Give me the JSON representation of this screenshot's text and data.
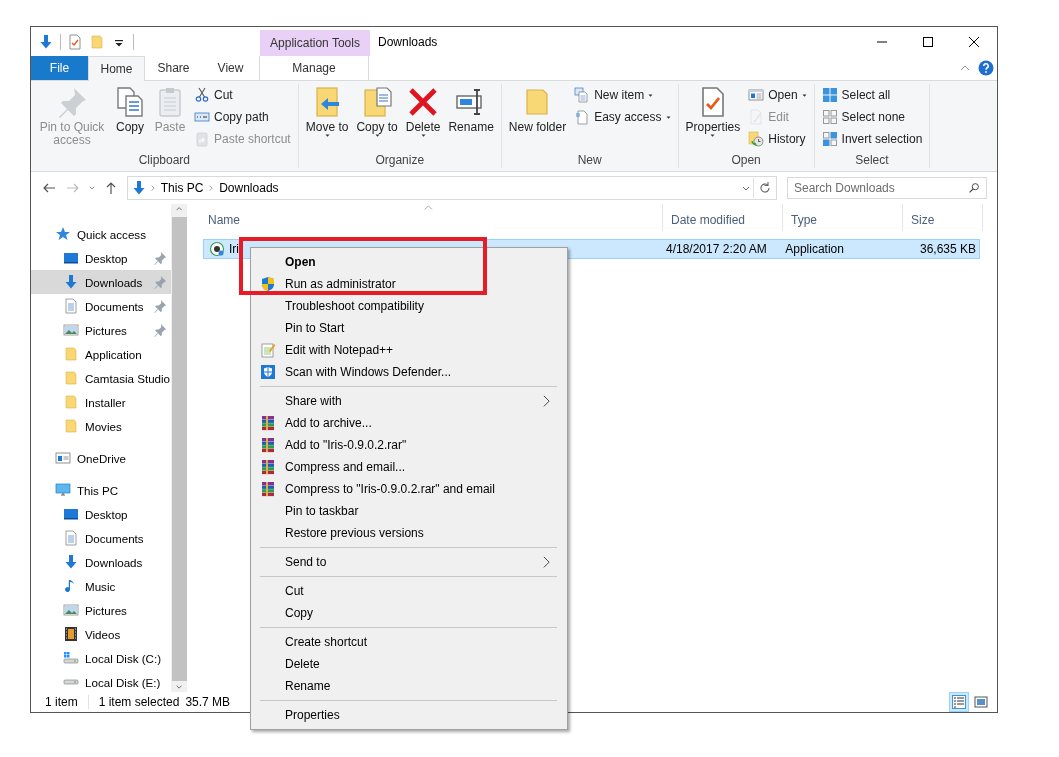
{
  "window": {
    "title": "Downloads",
    "contextual_tab_group": "Application Tools"
  },
  "ribbon_tabs": [
    {
      "label": "File",
      "kind": "file",
      "selected": false
    },
    {
      "label": "Home",
      "kind": "tab",
      "selected": true
    },
    {
      "label": "Share",
      "kind": "tab",
      "selected": false
    },
    {
      "label": "View",
      "kind": "tab",
      "selected": false
    },
    {
      "label": "Manage",
      "kind": "contextual",
      "selected": false
    }
  ],
  "ribbon_groups": [
    {
      "label": "Clipboard",
      "columns": [
        {
          "kind": "large",
          "commands": [
            {
              "label": "Pin to Quick access",
              "kind": "pin",
              "dropdown": false,
              "disabled": true
            }
          ]
        },
        {
          "kind": "large",
          "commands": [
            {
              "label": "Copy",
              "kind": "copy",
              "dropdown": false,
              "disabled": false
            }
          ]
        },
        {
          "kind": "large",
          "commands": [
            {
              "label": "Paste",
              "kind": "paste",
              "dropdown": false,
              "disabled": true
            }
          ]
        },
        {
          "kind": "stack",
          "commands": [
            {
              "label": "Cut",
              "kind": "cut",
              "dropdown": false,
              "disabled": false
            },
            {
              "label": "Copy path",
              "kind": "copy-path",
              "dropdown": false,
              "disabled": false
            },
            {
              "label": "Paste shortcut",
              "kind": "paste-shortcut",
              "dropdown": false,
              "disabled": true
            }
          ]
        }
      ]
    },
    {
      "label": "Organize",
      "columns": [
        {
          "kind": "large",
          "commands": [
            {
              "label": "Move to",
              "kind": "move",
              "dropdown": true,
              "disabled": false
            }
          ]
        },
        {
          "kind": "large",
          "commands": [
            {
              "label": "Copy to",
              "kind": "copy-to",
              "dropdown": true,
              "disabled": false
            }
          ]
        },
        {
          "kind": "large",
          "commands": [
            {
              "label": "Delete",
              "kind": "delete",
              "dropdown": true,
              "disabled": false
            }
          ]
        },
        {
          "kind": "large",
          "commands": [
            {
              "label": "Rename",
              "kind": "rename",
              "dropdown": false,
              "disabled": false
            }
          ]
        }
      ]
    },
    {
      "label": "New",
      "columns": [
        {
          "kind": "large",
          "commands": [
            {
              "label": "New folder",
              "kind": "folder",
              "dropdown": false,
              "disabled": false
            }
          ]
        },
        {
          "kind": "stack",
          "commands": [
            {
              "label": "New item",
              "kind": "new-item",
              "dropdown": true,
              "disabled": false
            },
            {
              "label": "Easy access",
              "kind": "easy-access",
              "dropdown": true,
              "disabled": false
            }
          ]
        }
      ]
    },
    {
      "label": "Open",
      "columns": [
        {
          "kind": "large",
          "commands": [
            {
              "label": "Properties",
              "kind": "properties",
              "dropdown": true,
              "disabled": false
            }
          ]
        },
        {
          "kind": "stack",
          "commands": [
            {
              "label": "Open",
              "kind": "open",
              "dropdown": true,
              "disabled": false
            },
            {
              "label": "Edit",
              "kind": "edit",
              "dropdown": false,
              "disabled": true
            },
            {
              "label": "History",
              "kind": "history",
              "dropdown": false,
              "disabled": false
            }
          ]
        }
      ]
    },
    {
      "label": "Select",
      "columns": [
        {
          "kind": "stack",
          "commands": [
            {
              "label": "Select all",
              "kind": "select-all",
              "dropdown": false,
              "disabled": false
            },
            {
              "label": "Select none",
              "kind": "select-none",
              "dropdown": false,
              "disabled": false
            },
            {
              "label": "Invert selection",
              "kind": "invert",
              "dropdown": false,
              "disabled": false
            }
          ]
        }
      ]
    }
  ],
  "address_bar": {
    "crumbs": [
      "This PC",
      "Downloads"
    ]
  },
  "search": {
    "placeholder": "Search Downloads"
  },
  "navigation": [
    {
      "label": "Quick access",
      "kind": "star",
      "pinned": false,
      "selected": false,
      "children": [
        {
          "label": "Desktop",
          "kind": "desktop",
          "pinned": true,
          "selected": false
        },
        {
          "label": "Downloads",
          "kind": "download",
          "pinned": true,
          "selected": true
        },
        {
          "label": "Documents",
          "kind": "document",
          "pinned": true,
          "selected": false
        },
        {
          "label": "Pictures",
          "kind": "picture",
          "pinned": true,
          "selected": false
        },
        {
          "label": "Application",
          "kind": "folder",
          "pinned": false,
          "selected": false
        },
        {
          "label": "Camtasia Studio",
          "kind": "folder",
          "pinned": false,
          "selected": false
        },
        {
          "label": "Installer",
          "kind": "folder",
          "pinned": false,
          "selected": false
        },
        {
          "label": "Movies",
          "kind": "folder",
          "pinned": false,
          "selected": false
        }
      ]
    },
    {
      "label": "OneDrive",
      "kind": "onedrive",
      "pinned": false,
      "selected": false
    },
    {
      "label": "This PC",
      "kind": "computer",
      "pinned": false,
      "selected": false,
      "children": [
        {
          "label": "Desktop",
          "kind": "desktop",
          "pinned": false,
          "selected": false
        },
        {
          "label": "Documents",
          "kind": "document",
          "pinned": false,
          "selected": false
        },
        {
          "label": "Downloads",
          "kind": "download",
          "pinned": false,
          "selected": false
        },
        {
          "label": "Music",
          "kind": "music",
          "pinned": false,
          "selected": false
        },
        {
          "label": "Pictures",
          "kind": "picture",
          "pinned": false,
          "selected": false
        },
        {
          "label": "Videos",
          "kind": "video",
          "pinned": false,
          "selected": false
        },
        {
          "label": "Local Disk (C:)",
          "kind": "system-disk",
          "pinned": false,
          "selected": false
        },
        {
          "label": "Local Disk (E:)",
          "kind": "disk",
          "pinned": false,
          "selected": false
        }
      ]
    }
  ],
  "file_list": {
    "columns": [
      {
        "label": "Name",
        "sorted": true
      },
      {
        "label": "Date modified",
        "sorted": false
      },
      {
        "label": "Type",
        "sorted": false
      },
      {
        "label": "Size",
        "sorted": false
      }
    ],
    "rows": [
      {
        "name": "Iri",
        "date_modified": "4/18/2017 2:20 AM",
        "type": "Application",
        "size": "36,635 KB",
        "selected": true
      }
    ]
  },
  "status_bar": {
    "item_count": "1 item",
    "selection": "1 item selected",
    "selection_size": "35.7 MB",
    "views": [
      {
        "kind": "details",
        "selected": true
      },
      {
        "kind": "large-icons",
        "selected": false
      }
    ]
  },
  "context_menu": {
    "groups": [
      [
        {
          "label": "Open",
          "kind": "none",
          "default": true,
          "submenu": false
        },
        {
          "label": "Run as administrator",
          "kind": "shield",
          "default": false,
          "submenu": false
        },
        {
          "label": "Troubleshoot compatibility",
          "kind": "none",
          "default": false,
          "submenu": false
        },
        {
          "label": "Pin to Start",
          "kind": "none",
          "default": false,
          "submenu": false
        },
        {
          "label": "Edit with Notepad++",
          "kind": "notepad",
          "default": false,
          "submenu": false
        },
        {
          "label": "Scan with Windows Defender...",
          "kind": "defender",
          "default": false,
          "submenu": false
        }
      ],
      [
        {
          "label": "Share with",
          "kind": "none",
          "default": false,
          "submenu": true
        },
        {
          "label": "Add to archive...",
          "kind": "archive",
          "default": false,
          "submenu": false
        },
        {
          "label": "Add to \"Iris-0.9.0.2.rar\"",
          "kind": "archive",
          "default": false,
          "submenu": false
        },
        {
          "label": "Compress and email...",
          "kind": "archive",
          "default": false,
          "submenu": false
        },
        {
          "label": "Compress to \"Iris-0.9.0.2.rar\" and email",
          "kind": "archive",
          "default": false,
          "submenu": false
        },
        {
          "label": "Pin to taskbar",
          "kind": "none",
          "default": false,
          "submenu": false
        },
        {
          "label": "Restore previous versions",
          "kind": "none",
          "default": false,
          "submenu": false
        }
      ],
      [
        {
          "label": "Send to",
          "kind": "none",
          "default": false,
          "submenu": true
        }
      ],
      [
        {
          "label": "Cut",
          "kind": "none",
          "default": false,
          "submenu": false
        },
        {
          "label": "Copy",
          "kind": "none",
          "default": false,
          "submenu": false
        }
      ],
      [
        {
          "label": "Create shortcut",
          "kind": "none",
          "default": false,
          "submenu": false
        },
        {
          "label": "Delete",
          "kind": "none",
          "default": false,
          "submenu": false
        },
        {
          "label": "Rename",
          "kind": "none",
          "default": false,
          "submenu": false
        }
      ],
      [
        {
          "label": "Properties",
          "kind": "none",
          "default": false,
          "submenu": false
        }
      ]
    ]
  }
}
